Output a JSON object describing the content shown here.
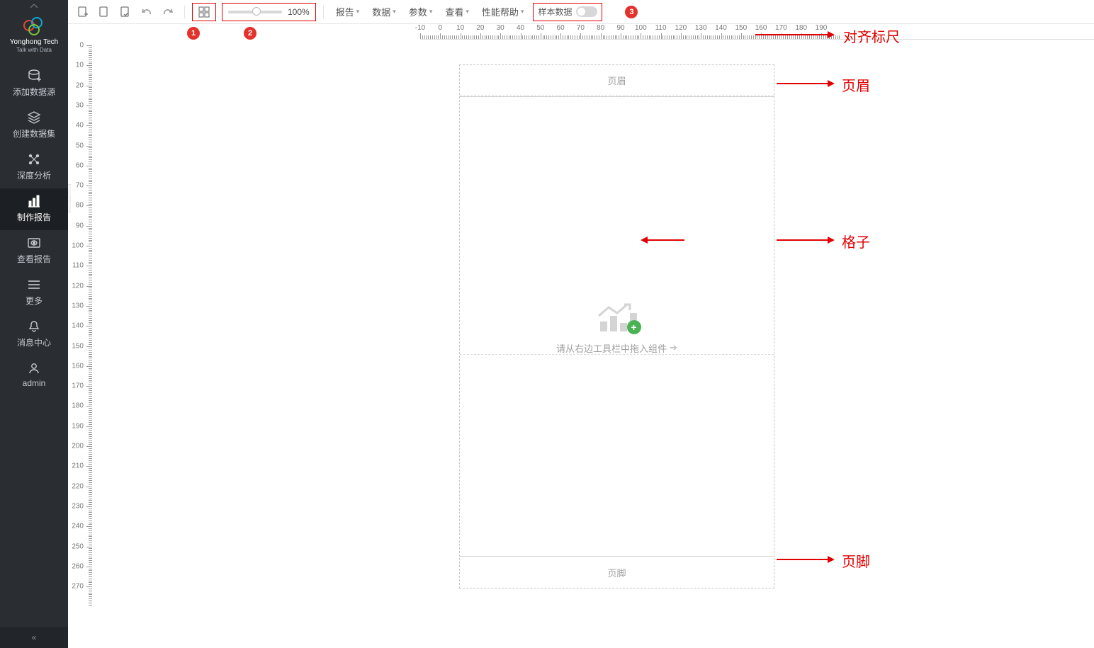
{
  "brand": {
    "name": "Yonghong Tech",
    "tagline": "Talk with Data"
  },
  "sidebar": {
    "items": [
      {
        "label": "添加数据源",
        "icon": "datasource"
      },
      {
        "label": "创建数据集",
        "icon": "dataset"
      },
      {
        "label": "深度分析",
        "icon": "nodes"
      },
      {
        "label": "制作报告",
        "icon": "chart",
        "active": true
      },
      {
        "label": "查看报告",
        "icon": "view"
      },
      {
        "label": "更多",
        "icon": "menu"
      },
      {
        "label": "消息中心",
        "icon": "bell"
      },
      {
        "label": "admin",
        "icon": "user"
      }
    ],
    "collapse": "«"
  },
  "toolbar": {
    "zoom": "100%",
    "menus": {
      "report": "报告",
      "data": "数据",
      "params": "参数",
      "view": "查看",
      "perf": "性能帮助",
      "sample": "样本数据"
    }
  },
  "badges": {
    "b1": "1",
    "b2": "2",
    "b3": "3"
  },
  "rulers": {
    "h": [
      "-10",
      "0",
      "10",
      "20",
      "30",
      "40",
      "50",
      "60",
      "70",
      "80",
      "90",
      "100",
      "110",
      "120",
      "130",
      "140",
      "150",
      "160",
      "170",
      "180",
      "190"
    ],
    "v": [
      "0",
      "10",
      "20",
      "30",
      "40",
      "50",
      "60",
      "70",
      "80",
      "90",
      "100",
      "110",
      "120",
      "130",
      "140",
      "150",
      "160",
      "170",
      "180",
      "190",
      "200",
      "210",
      "220",
      "230",
      "240",
      "250",
      "260",
      "270"
    ]
  },
  "page": {
    "header": "页眉",
    "footer": "页脚",
    "placeholder": "请从右边工具栏中拖入组件",
    "placeholder_arrow": "➔"
  },
  "annotations": {
    "ruler": "对齐标尺",
    "header": "页眉",
    "body": "格子",
    "footer": "页脚"
  }
}
